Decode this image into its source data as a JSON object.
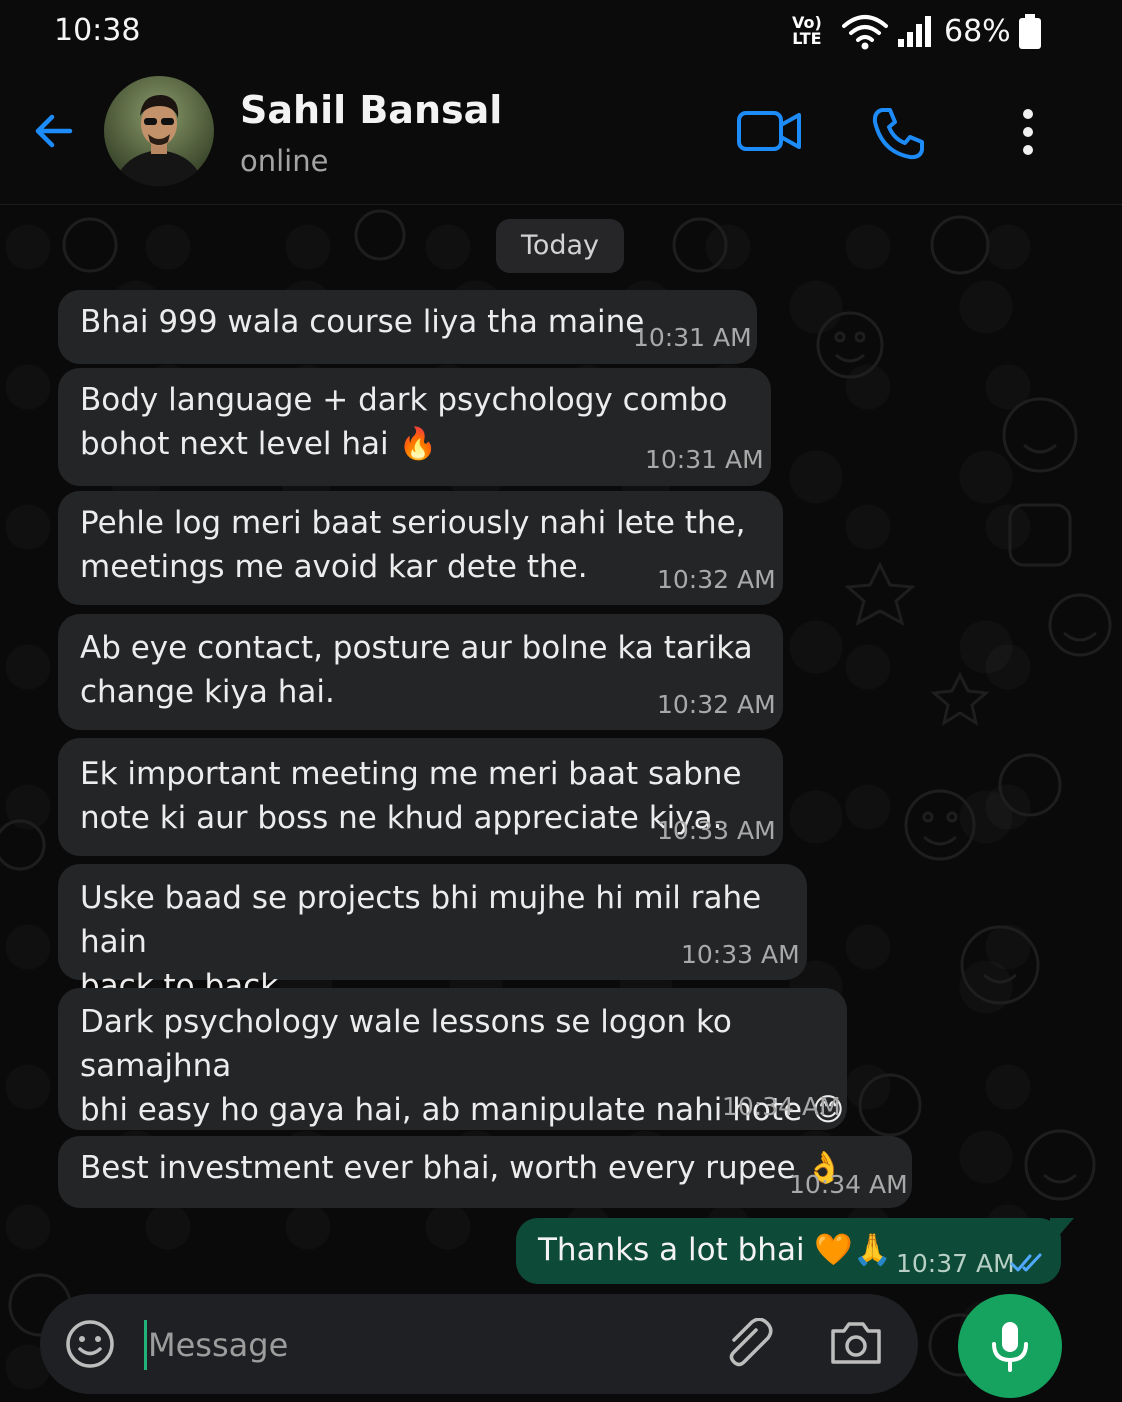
{
  "status_bar": {
    "time": "10:38",
    "volte_top": "Vo)",
    "volte_bottom": "LTE",
    "battery": "68%"
  },
  "header": {
    "contact_name": "Sahil Bansal",
    "contact_status": "online",
    "icons": [
      "back-arrow-icon",
      "video-call-icon",
      "voice-call-icon",
      "more-options-icon"
    ],
    "accent_color": "#1d8cf8"
  },
  "chat": {
    "date_label": "Today",
    "incoming": [
      {
        "text": "Bhai 999 wala course liya tha maine",
        "time": "10:31 AM"
      },
      {
        "text": "Body language + dark psychology combo\nbohot next level hai 🔥",
        "time": "10:31 AM"
      },
      {
        "text": "Pehle log meri baat seriously nahi lete the,\nmeetings me avoid kar dete the.",
        "time": "10:32 AM"
      },
      {
        "text": "Ab eye contact, posture aur bolne ka tarika\nchange kiya hai.",
        "time": "10:32 AM"
      },
      {
        "text": "Ek important meeting me meri baat sabne\nnote ki aur boss ne khud appreciate kiya.",
        "time": "10:33 AM"
      },
      {
        "text": "Uske baad se projects bhi mujhe hi mil rahe hain\nback to back.",
        "time": "10:33 AM"
      },
      {
        "text": "Dark psychology wale lessons se logon ko samajhna\nbhi easy ho gaya hai, ab manipulate nahi hote 😊",
        "time": "10:34 AM"
      },
      {
        "text": "Best investment ever bhai, worth every rupee 👌",
        "time": "10:34 AM"
      }
    ],
    "outgoing": {
      "text": "Thanks a lot bhai 🧡🙏",
      "time": "10:37 AM",
      "status": "read"
    },
    "incoming_bubble_color": "#242527",
    "outgoing_bubble_color": "#0d4a37"
  },
  "composer": {
    "placeholder": "Message",
    "value": "",
    "icons": [
      "emoji-icon",
      "attach-icon",
      "camera-icon",
      "microphone-icon"
    ],
    "mic_color": "#15a35f"
  }
}
